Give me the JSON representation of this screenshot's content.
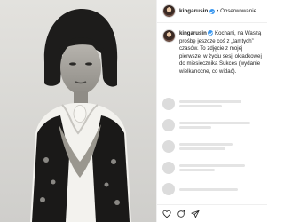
{
  "post": {
    "username": "kingarusin",
    "follow_label": "Obserwowanie",
    "caption_username": "kingarusin",
    "caption_text": "Kochani, na Waszą prośbę jeszcze coś z „tamtych” czasów. To zdjęcie z mojej pierwszej w życiu sesji okładkowej do miesięcznika Sukces (wydanie wielkanocne, co widać)."
  },
  "colors": {
    "verified": "#3897f0",
    "border": "#efefef"
  },
  "icons": [
    "verified-badge-icon",
    "heart-icon",
    "comment-icon",
    "share-icon"
  ]
}
